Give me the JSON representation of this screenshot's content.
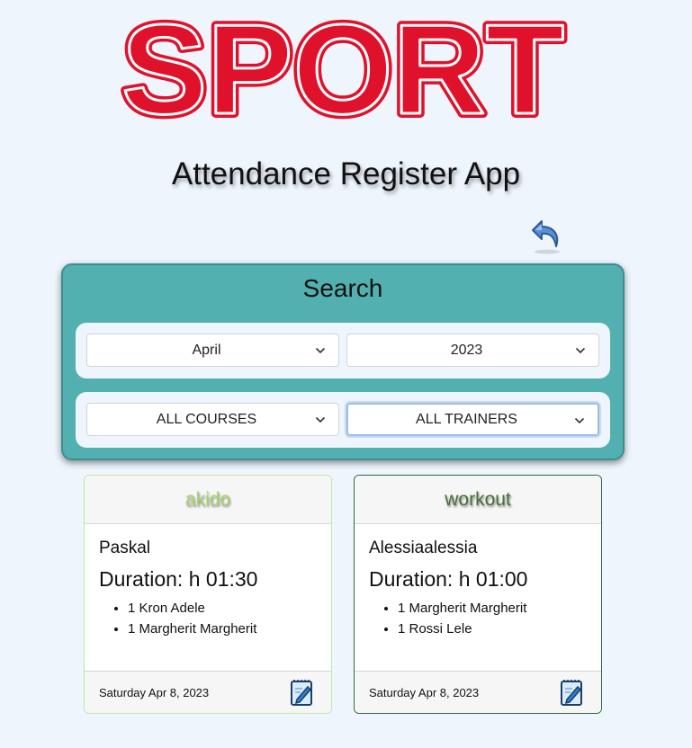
{
  "logo": {
    "text": "SPORT"
  },
  "app_title": "Attendance Register App",
  "nav": {
    "back_icon": "undo-arrow-icon"
  },
  "search": {
    "title": "Search",
    "month": "April",
    "year": "2023",
    "course": "ALL COURSES",
    "trainer": "ALL TRAINERS"
  },
  "cards": [
    {
      "course": "akido",
      "trainer": "Paskal",
      "duration": "Duration: h 01:30",
      "attendees": [
        "1 Kron Adele",
        "1 Margherit Margherit"
      ],
      "date": "Saturday Apr 8, 2023",
      "edit_icon": "notepad-edit-icon"
    },
    {
      "course": "workout",
      "trainer": "Alessiaalessia",
      "duration": "Duration: h 01:00",
      "attendees": [
        "1 Margherit Margherit",
        "1 Rossi Lele"
      ],
      "date": "Saturday Apr 8, 2023",
      "edit_icon": "notepad-edit-icon"
    }
  ],
  "colors": {
    "background": "#eef5fd",
    "logo_red": "#e0112b",
    "panel": "#52b1b0",
    "akido": "#a7d36c",
    "workout": "#4a6e3a"
  }
}
